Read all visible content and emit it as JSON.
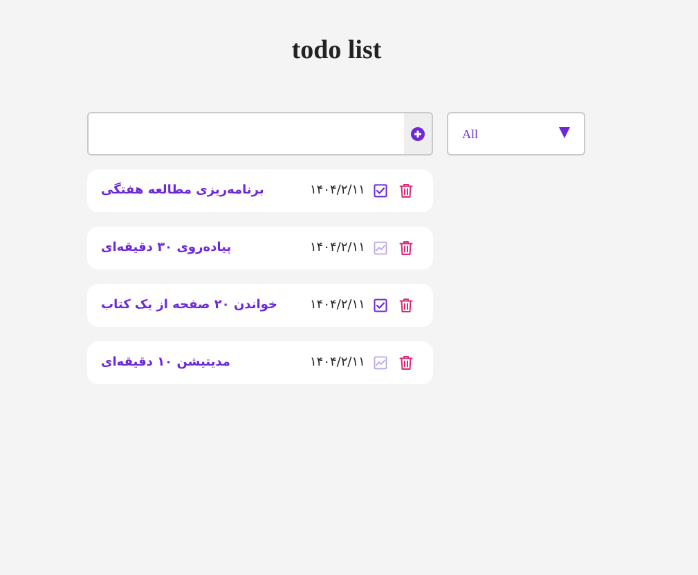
{
  "header": {
    "title": "todo list"
  },
  "toolbar": {
    "input_value": "",
    "input_placeholder": "",
    "filter_selected": "All"
  },
  "colors": {
    "accent": "#6d28d9",
    "delete": "#db2777",
    "background": "#f4f4f4"
  },
  "todos": [
    {
      "text": "برنامه‌ریزی مطالعه هفتگی",
      "date": "۱۴۰۴/۲/۱۱",
      "status_icon": "check-square-icon"
    },
    {
      "text": "پیاده‌روی ۳۰ دقیقه‌ای",
      "date": "۱۴۰۴/۲/۱۱",
      "status_icon": "chart-line-icon"
    },
    {
      "text": "خواندن ۲۰ صفحه از یک کتاب",
      "date": "۱۴۰۴/۲/۱۱",
      "status_icon": "check-square-icon"
    },
    {
      "text": "مدیتیشن ۱۰ دقیقه‌ای",
      "date": "۱۴۰۴/۲/۱۱",
      "status_icon": "chart-line-icon"
    }
  ]
}
